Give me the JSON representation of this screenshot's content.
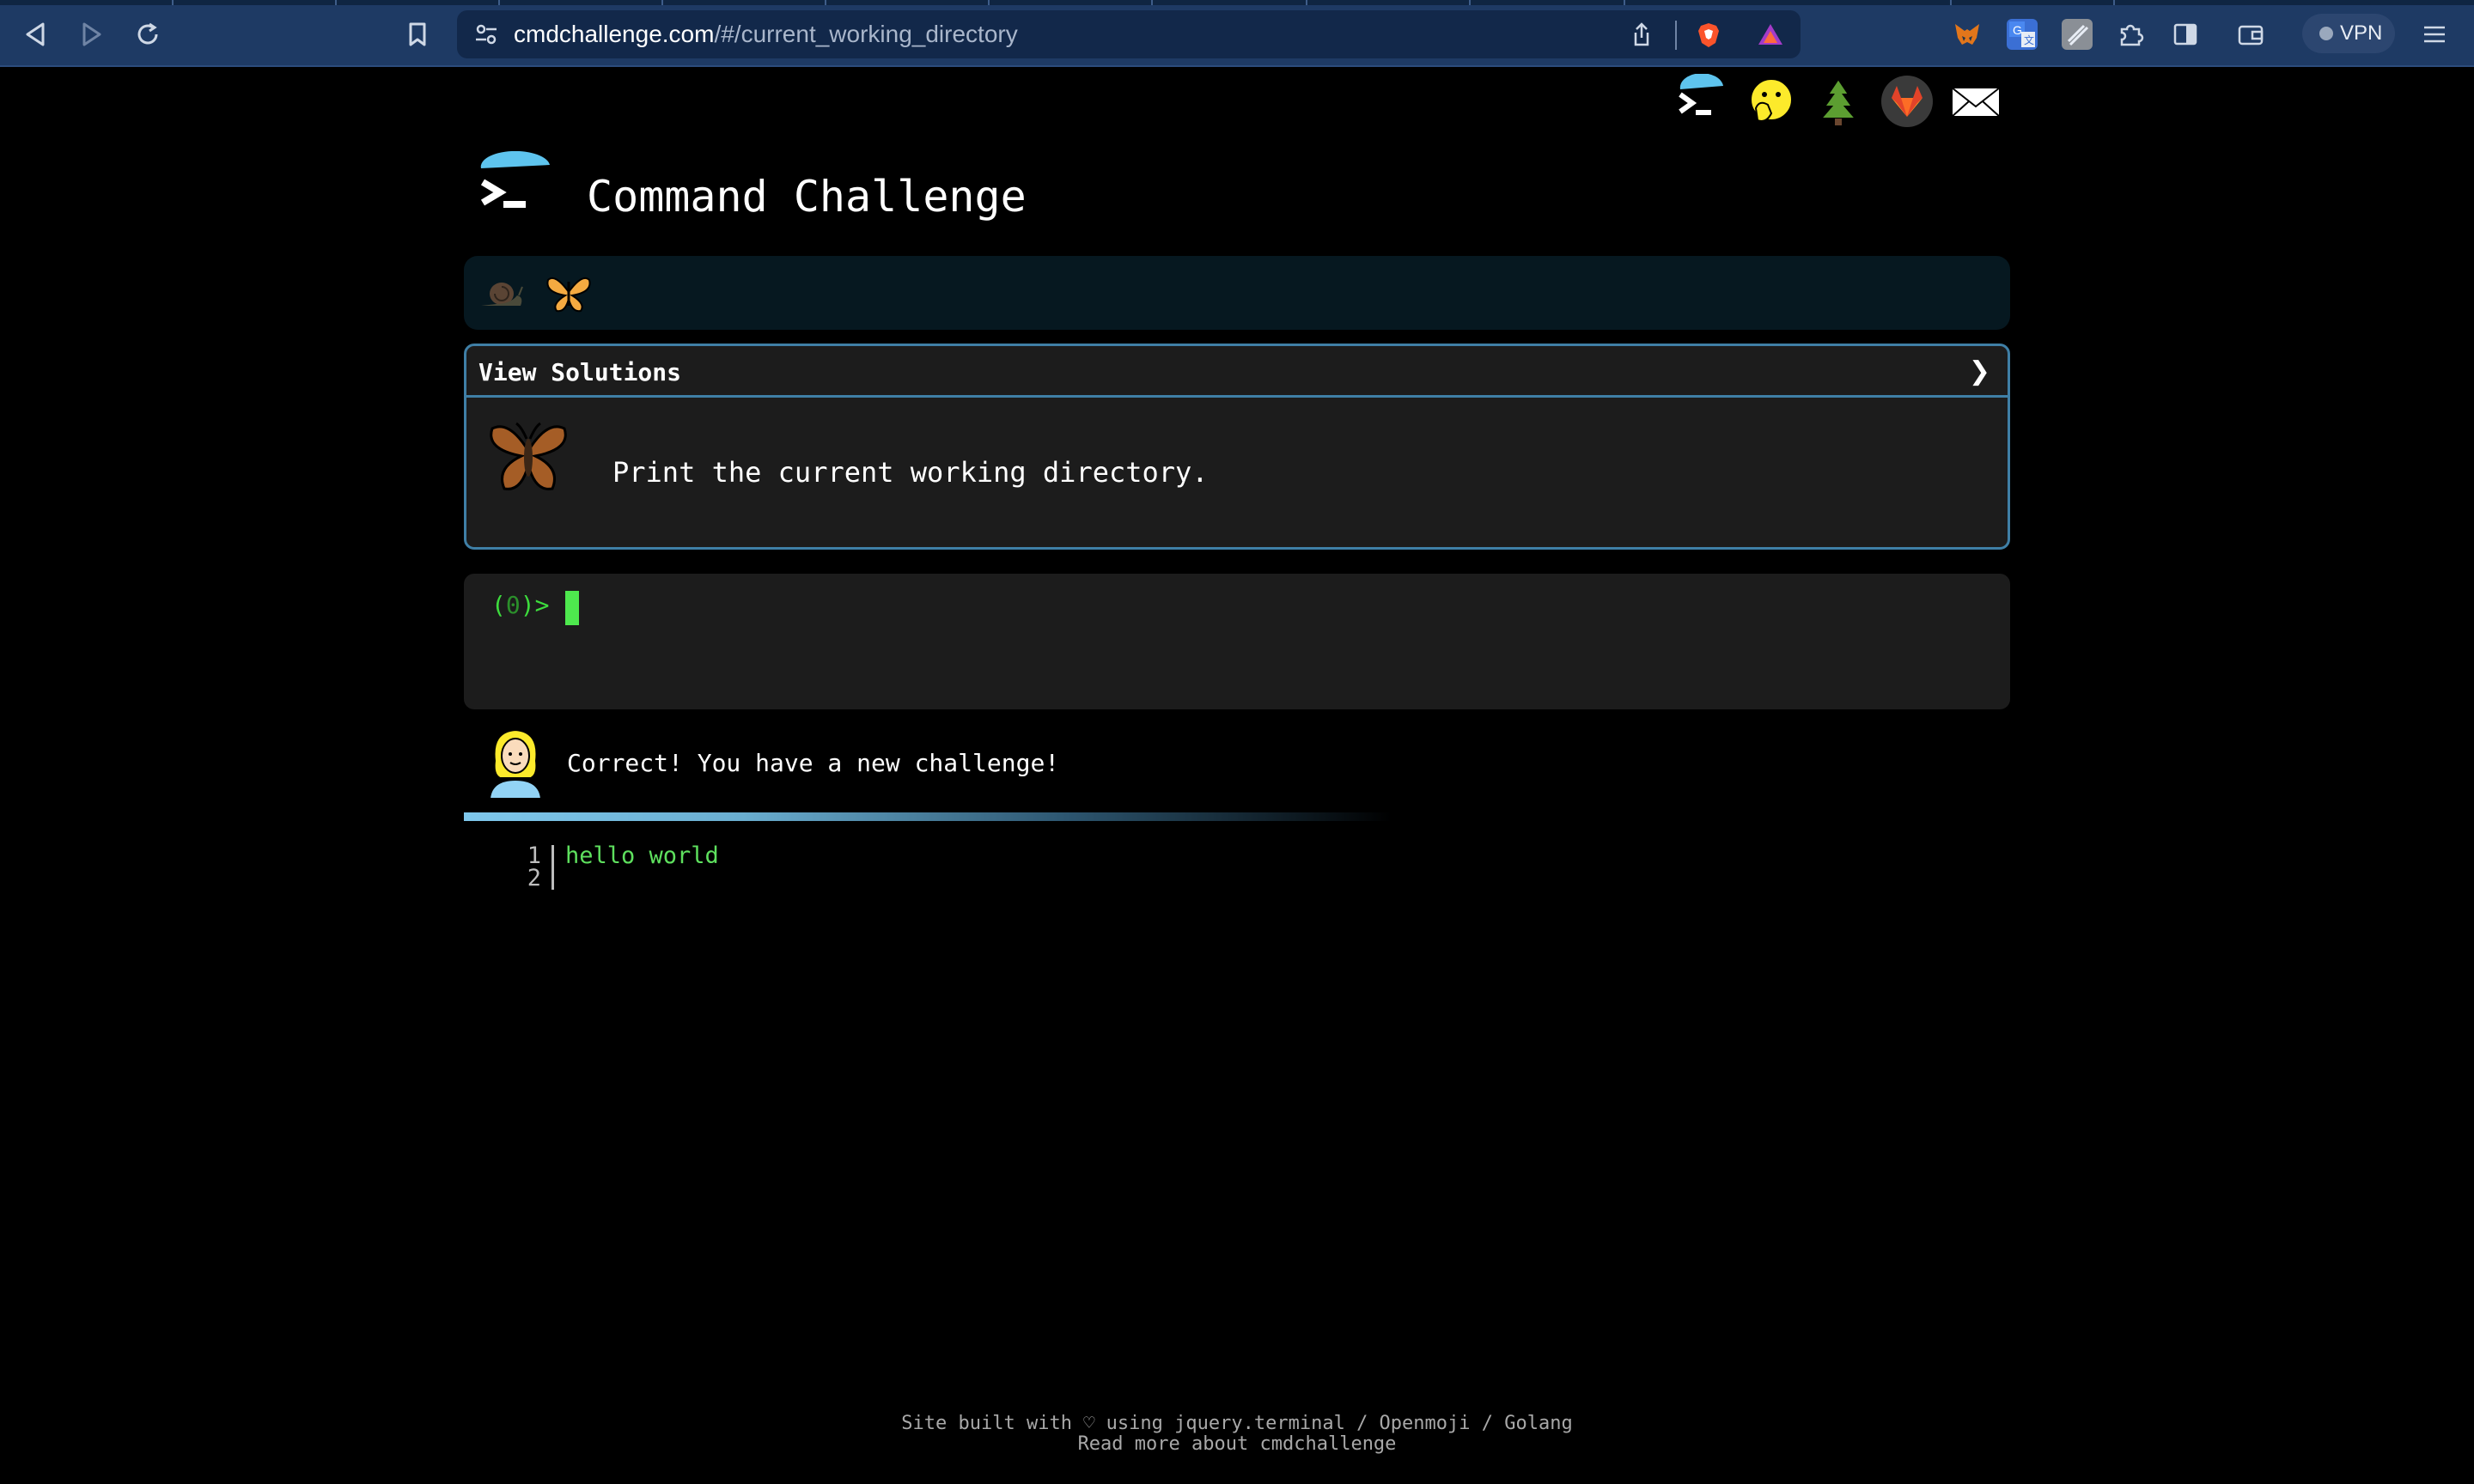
{
  "browser": {
    "url_host": "cmdchallenge.com",
    "url_path": "/#/current_working_directory",
    "vpn_label": "VPN"
  },
  "site": {
    "title": "Command Challenge"
  },
  "progress": {
    "items": [
      {
        "icon": "snail-icon",
        "state": "dim"
      },
      {
        "icon": "butterfly-icon",
        "state": "current"
      }
    ]
  },
  "challenge": {
    "view_solutions_label": "View Solutions",
    "chevron": "❯",
    "description": "Print the current working directory.",
    "icon": "butterfly-icon"
  },
  "terminal": {
    "prompt_open": "(",
    "prompt_count": "0",
    "prompt_close": ")>"
  },
  "feedback": {
    "message": "Correct! You have a new challenge!"
  },
  "output": {
    "lines": [
      {
        "number": "1",
        "text": "hello world"
      },
      {
        "number": "2",
        "text": ""
      }
    ]
  },
  "footer": {
    "line1": "Site built with ♡ using jquery.terminal / Openmoji / Golang",
    "line2": "Read more about cmdchallenge"
  },
  "colors": {
    "accent_border": "#3f7fa6",
    "prompt_green": "#3ddc3d",
    "output_green": "#5ee05e",
    "chrome_blue": "#1e3a64"
  }
}
